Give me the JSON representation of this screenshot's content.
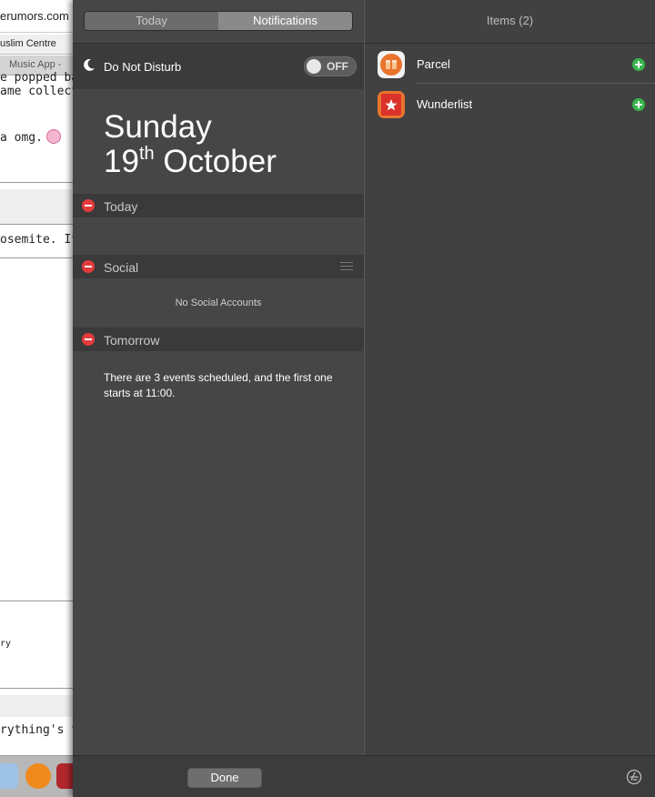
{
  "background_browser": {
    "url_fragment": "erumors.com",
    "tab1": "uslim Centre",
    "tab2": "Music App - ",
    "line1": "e popped bac",
    "line2": "ame collectio",
    "line3": "a omg.",
    "line4": "osemite. It's",
    "line5": "ry",
    "line6": "rything's the"
  },
  "segmented": {
    "today": "Today",
    "notifications": "Notifications"
  },
  "do_not_disturb": {
    "label": "Do Not Disturb",
    "toggle": "OFF"
  },
  "date": {
    "weekday": "Sunday",
    "day": "19",
    "suffix": "th",
    "month": "October"
  },
  "sections": {
    "today": "Today",
    "social": "Social",
    "tomorrow": "Tomorrow"
  },
  "social_empty": "No Social Accounts",
  "tomorrow_text": "There are 3 events scheduled, and the first one starts at 11:00.",
  "items": {
    "title": "Items (2)",
    "list": [
      {
        "label": "Parcel",
        "icon": "parcel-icon"
      },
      {
        "label": "Wunderlist",
        "icon": "wunderlist-icon"
      }
    ]
  },
  "footer": {
    "done": "Done"
  },
  "colors": {
    "minus": "#e33b3b",
    "add": "#38b44a",
    "parcel": "#e8742e",
    "wunderlist": "#d9332b"
  }
}
